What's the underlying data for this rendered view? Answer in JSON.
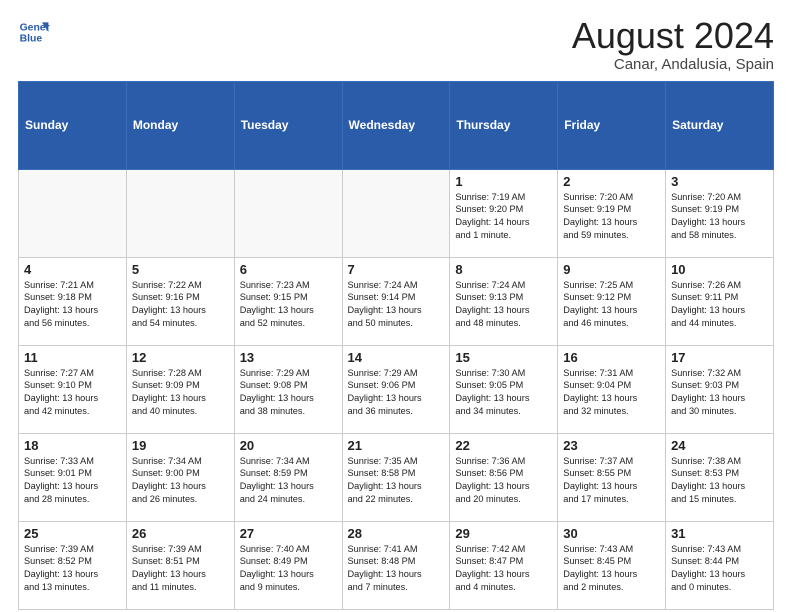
{
  "header": {
    "logo_line1": "General",
    "logo_line2": "Blue",
    "title": "August 2024",
    "subtitle": "Canar, Andalusia, Spain"
  },
  "weekdays": [
    "Sunday",
    "Monday",
    "Tuesday",
    "Wednesday",
    "Thursday",
    "Friday",
    "Saturday"
  ],
  "weeks": [
    [
      {
        "day": "",
        "empty": true
      },
      {
        "day": "",
        "empty": true
      },
      {
        "day": "",
        "empty": true
      },
      {
        "day": "",
        "empty": true
      },
      {
        "day": "1",
        "info": "Sunrise: 7:19 AM\nSunset: 9:20 PM\nDaylight: 14 hours\nand 1 minute."
      },
      {
        "day": "2",
        "info": "Sunrise: 7:20 AM\nSunset: 9:19 PM\nDaylight: 13 hours\nand 59 minutes."
      },
      {
        "day": "3",
        "info": "Sunrise: 7:20 AM\nSunset: 9:19 PM\nDaylight: 13 hours\nand 58 minutes."
      }
    ],
    [
      {
        "day": "4",
        "info": "Sunrise: 7:21 AM\nSunset: 9:18 PM\nDaylight: 13 hours\nand 56 minutes."
      },
      {
        "day": "5",
        "info": "Sunrise: 7:22 AM\nSunset: 9:16 PM\nDaylight: 13 hours\nand 54 minutes."
      },
      {
        "day": "6",
        "info": "Sunrise: 7:23 AM\nSunset: 9:15 PM\nDaylight: 13 hours\nand 52 minutes."
      },
      {
        "day": "7",
        "info": "Sunrise: 7:24 AM\nSunset: 9:14 PM\nDaylight: 13 hours\nand 50 minutes."
      },
      {
        "day": "8",
        "info": "Sunrise: 7:24 AM\nSunset: 9:13 PM\nDaylight: 13 hours\nand 48 minutes."
      },
      {
        "day": "9",
        "info": "Sunrise: 7:25 AM\nSunset: 9:12 PM\nDaylight: 13 hours\nand 46 minutes."
      },
      {
        "day": "10",
        "info": "Sunrise: 7:26 AM\nSunset: 9:11 PM\nDaylight: 13 hours\nand 44 minutes."
      }
    ],
    [
      {
        "day": "11",
        "info": "Sunrise: 7:27 AM\nSunset: 9:10 PM\nDaylight: 13 hours\nand 42 minutes."
      },
      {
        "day": "12",
        "info": "Sunrise: 7:28 AM\nSunset: 9:09 PM\nDaylight: 13 hours\nand 40 minutes."
      },
      {
        "day": "13",
        "info": "Sunrise: 7:29 AM\nSunset: 9:08 PM\nDaylight: 13 hours\nand 38 minutes."
      },
      {
        "day": "14",
        "info": "Sunrise: 7:29 AM\nSunset: 9:06 PM\nDaylight: 13 hours\nand 36 minutes."
      },
      {
        "day": "15",
        "info": "Sunrise: 7:30 AM\nSunset: 9:05 PM\nDaylight: 13 hours\nand 34 minutes."
      },
      {
        "day": "16",
        "info": "Sunrise: 7:31 AM\nSunset: 9:04 PM\nDaylight: 13 hours\nand 32 minutes."
      },
      {
        "day": "17",
        "info": "Sunrise: 7:32 AM\nSunset: 9:03 PM\nDaylight: 13 hours\nand 30 minutes."
      }
    ],
    [
      {
        "day": "18",
        "info": "Sunrise: 7:33 AM\nSunset: 9:01 PM\nDaylight: 13 hours\nand 28 minutes."
      },
      {
        "day": "19",
        "info": "Sunrise: 7:34 AM\nSunset: 9:00 PM\nDaylight: 13 hours\nand 26 minutes."
      },
      {
        "day": "20",
        "info": "Sunrise: 7:34 AM\nSunset: 8:59 PM\nDaylight: 13 hours\nand 24 minutes."
      },
      {
        "day": "21",
        "info": "Sunrise: 7:35 AM\nSunset: 8:58 PM\nDaylight: 13 hours\nand 22 minutes."
      },
      {
        "day": "22",
        "info": "Sunrise: 7:36 AM\nSunset: 8:56 PM\nDaylight: 13 hours\nand 20 minutes."
      },
      {
        "day": "23",
        "info": "Sunrise: 7:37 AM\nSunset: 8:55 PM\nDaylight: 13 hours\nand 17 minutes."
      },
      {
        "day": "24",
        "info": "Sunrise: 7:38 AM\nSunset: 8:53 PM\nDaylight: 13 hours\nand 15 minutes."
      }
    ],
    [
      {
        "day": "25",
        "info": "Sunrise: 7:39 AM\nSunset: 8:52 PM\nDaylight: 13 hours\nand 13 minutes."
      },
      {
        "day": "26",
        "info": "Sunrise: 7:39 AM\nSunset: 8:51 PM\nDaylight: 13 hours\nand 11 minutes."
      },
      {
        "day": "27",
        "info": "Sunrise: 7:40 AM\nSunset: 8:49 PM\nDaylight: 13 hours\nand 9 minutes."
      },
      {
        "day": "28",
        "info": "Sunrise: 7:41 AM\nSunset: 8:48 PM\nDaylight: 13 hours\nand 7 minutes."
      },
      {
        "day": "29",
        "info": "Sunrise: 7:42 AM\nSunset: 8:47 PM\nDaylight: 13 hours\nand 4 minutes."
      },
      {
        "day": "30",
        "info": "Sunrise: 7:43 AM\nSunset: 8:45 PM\nDaylight: 13 hours\nand 2 minutes."
      },
      {
        "day": "31",
        "info": "Sunrise: 7:43 AM\nSunset: 8:44 PM\nDaylight: 13 hours\nand 0 minutes."
      }
    ]
  ]
}
